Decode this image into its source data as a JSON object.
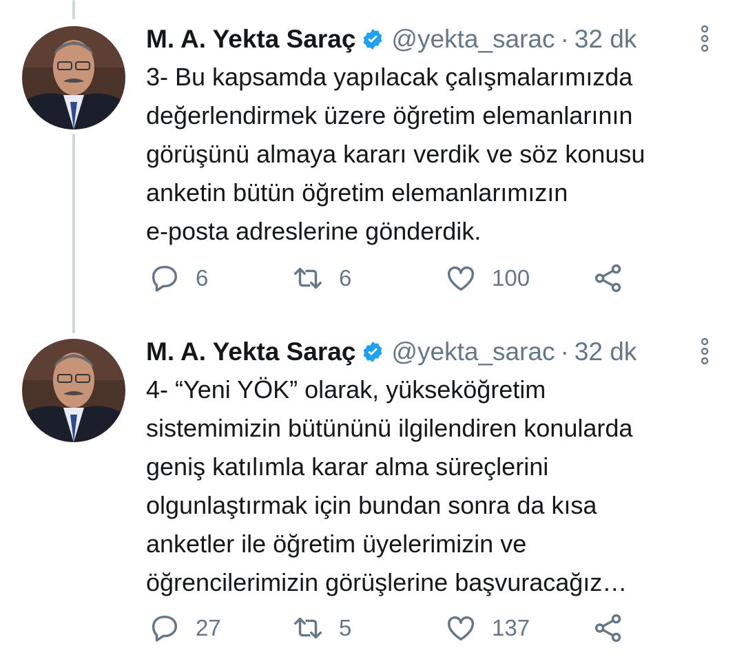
{
  "tweets": [
    {
      "display_name": "M. A. Yekta Saraç",
      "handle": "@yekta_sarac",
      "separator": "·",
      "time": "32 dk",
      "text": "3- Bu kapsamda yapılacak çalışmalarımızda\ndeğerlendirmek üzere öğretim elemanlarının\ngörüşünü almaya kararı verdik ve söz konusu\nanketin bütün öğretim elemanlarımızın\ne-posta adreslerine gönderdik.",
      "replies": "6",
      "retweets": "6",
      "likes": "100"
    },
    {
      "display_name": "M. A. Yekta Saraç",
      "handle": "@yekta_sarac",
      "separator": "·",
      "time": "32 dk",
      "text": "4- “Yeni YÖK” olarak, yükseköğretim\nsistemimizin bütününü ilgilendiren konularda\ngeniş katılımla karar alma süreçlerini\nolgunlaştırmak için bundan sonra da kısa\nanketler ile öğretim üyelerimizin ve\nöğrencilerimizin görüşlerine başvuracağız…",
      "replies": "27",
      "retweets": "5",
      "likes": "137"
    }
  ],
  "colors": {
    "accent": "#1da1f2",
    "text": "#14171a",
    "muted": "#657786",
    "thread_line": "#ccd6dd"
  },
  "icons": [
    "verified-badge-icon",
    "more-options-icon",
    "reply-icon",
    "retweet-icon",
    "like-icon",
    "share-icon"
  ]
}
